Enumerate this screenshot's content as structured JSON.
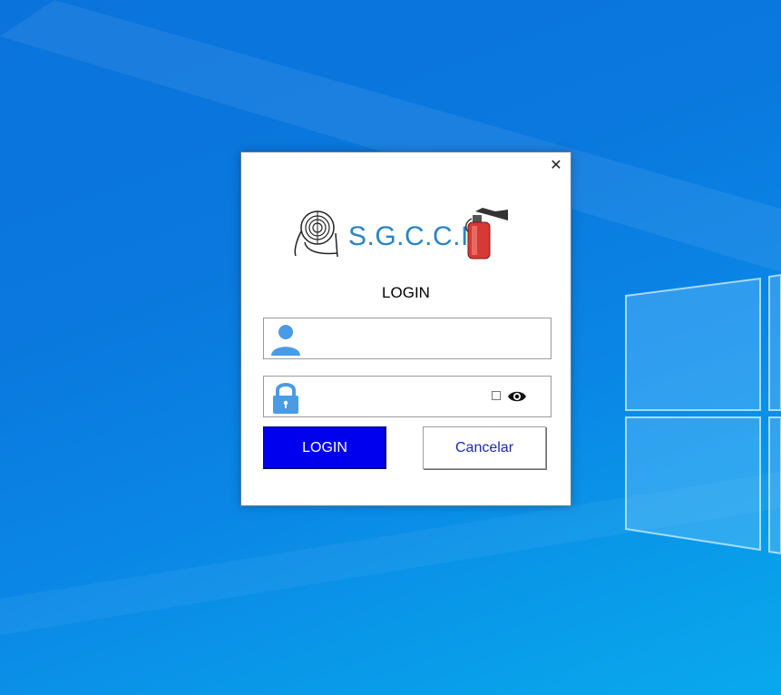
{
  "dialog": {
    "close_glyph": "✕",
    "logo_text": "S.G.C.C.I",
    "title": "LOGIN",
    "username": {
      "value": "",
      "placeholder": "",
      "icon": "user-icon"
    },
    "password": {
      "value": "",
      "placeholder": "",
      "icon": "lock-icon",
      "show_password_checked": false,
      "show_icon": "eye-icon"
    },
    "login_label": "LOGIN",
    "cancel_label": "Cancelar"
  },
  "colors": {
    "login_button_bg": "#0000ee",
    "cancel_text": "#1a2aa8",
    "logo_text": "#2a84c3",
    "icon_blue": "#4a9be6",
    "desktop_blue": "#0a78de"
  }
}
